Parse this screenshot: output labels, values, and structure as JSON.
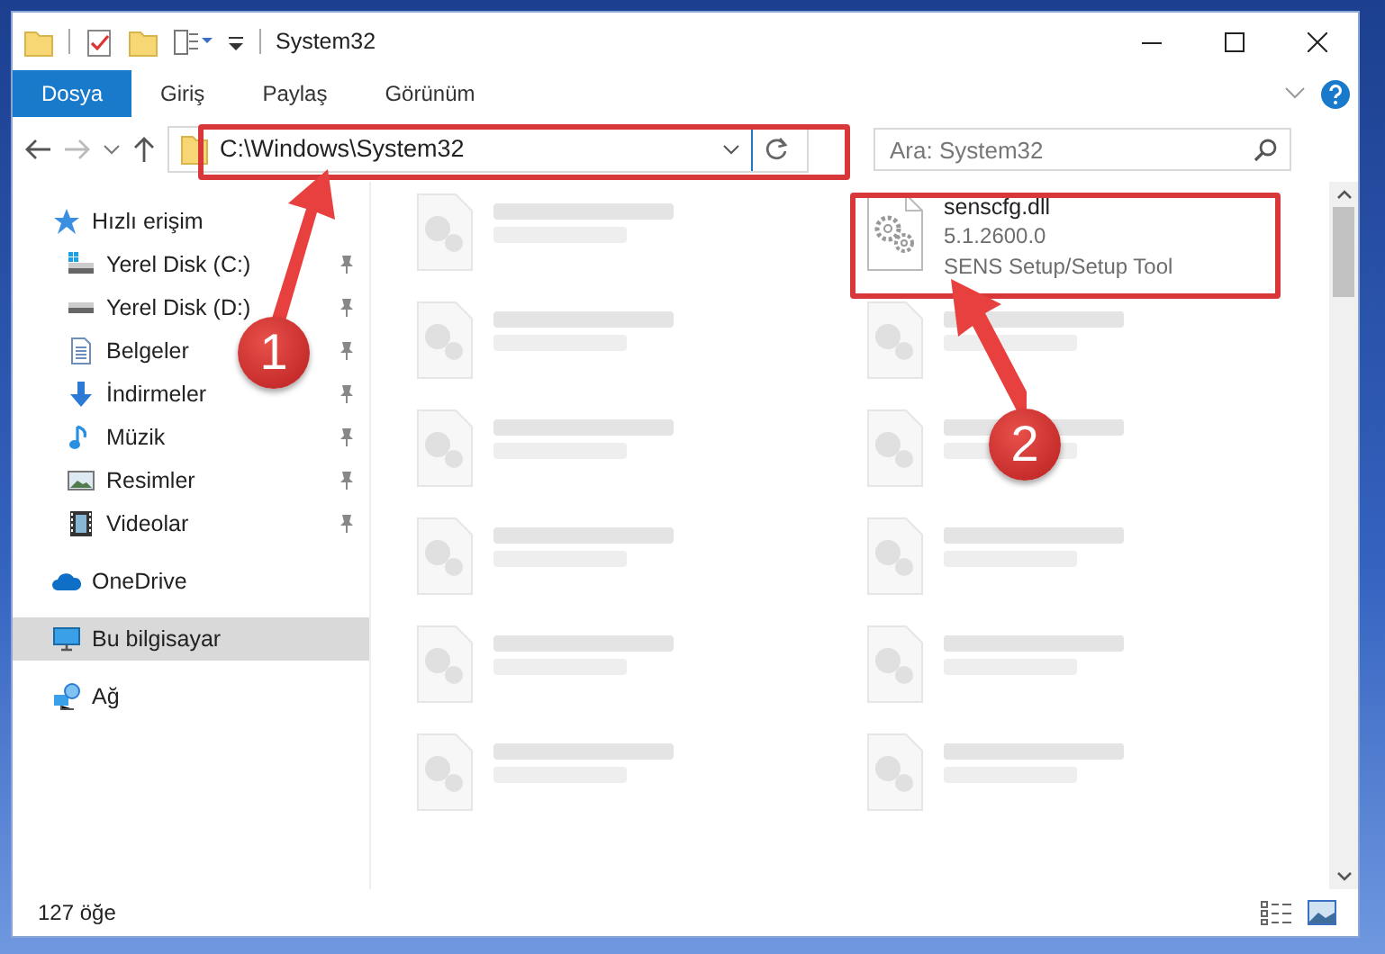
{
  "window": {
    "title": "System32"
  },
  "ribbon_tabs": [
    {
      "label": "Dosya",
      "selected": true
    },
    {
      "label": "Giriş",
      "selected": false
    },
    {
      "label": "Paylaş",
      "selected": false
    },
    {
      "label": "Görünüm",
      "selected": false
    }
  ],
  "address": {
    "path": "C:\\Windows\\System32"
  },
  "search": {
    "placeholder": "Ara: System32"
  },
  "sidebar": {
    "items": [
      {
        "label": "Hızlı erişim",
        "kind": "star",
        "selected": false,
        "children": [
          {
            "label": "Yerel Disk (C:)",
            "kind": "drive_os",
            "pinned": true,
            "selected": false
          },
          {
            "label": "Yerel Disk (D:)",
            "kind": "drive",
            "pinned": true,
            "selected": false
          },
          {
            "label": "Belgeler",
            "kind": "documents",
            "pinned": true,
            "selected": false
          },
          {
            "label": "İndirmeler",
            "kind": "downloads",
            "pinned": true,
            "selected": false
          },
          {
            "label": "Müzik",
            "kind": "music",
            "pinned": true,
            "selected": false
          },
          {
            "label": "Resimler",
            "kind": "pictures",
            "pinned": true,
            "selected": false
          },
          {
            "label": "Videolar",
            "kind": "videos",
            "pinned": true,
            "selected": false
          }
        ]
      },
      {
        "label": "OneDrive",
        "kind": "cloud",
        "selected": false
      },
      {
        "label": "Bu bilgisayar",
        "kind": "computer",
        "selected": true
      },
      {
        "label": "Ağ",
        "kind": "network",
        "selected": false
      }
    ]
  },
  "files": [
    {
      "kind": "blurred"
    },
    {
      "kind": "file",
      "name": "senscfg.dll",
      "details": [
        "5.1.2600.0",
        "SENS Setup/Setup Tool"
      ]
    },
    {
      "kind": "blurred"
    },
    {
      "kind": "blurred"
    },
    {
      "kind": "blurred"
    },
    {
      "kind": "blurred"
    },
    {
      "kind": "blurred"
    },
    {
      "kind": "blurred"
    },
    {
      "kind": "blurred"
    },
    {
      "kind": "blurred"
    },
    {
      "kind": "blurred"
    },
    {
      "kind": "blurred"
    }
  ],
  "status_bar": {
    "item_count": "127 öğe"
  },
  "annotations": [
    {
      "number": "1"
    },
    {
      "number": "2"
    }
  ]
}
